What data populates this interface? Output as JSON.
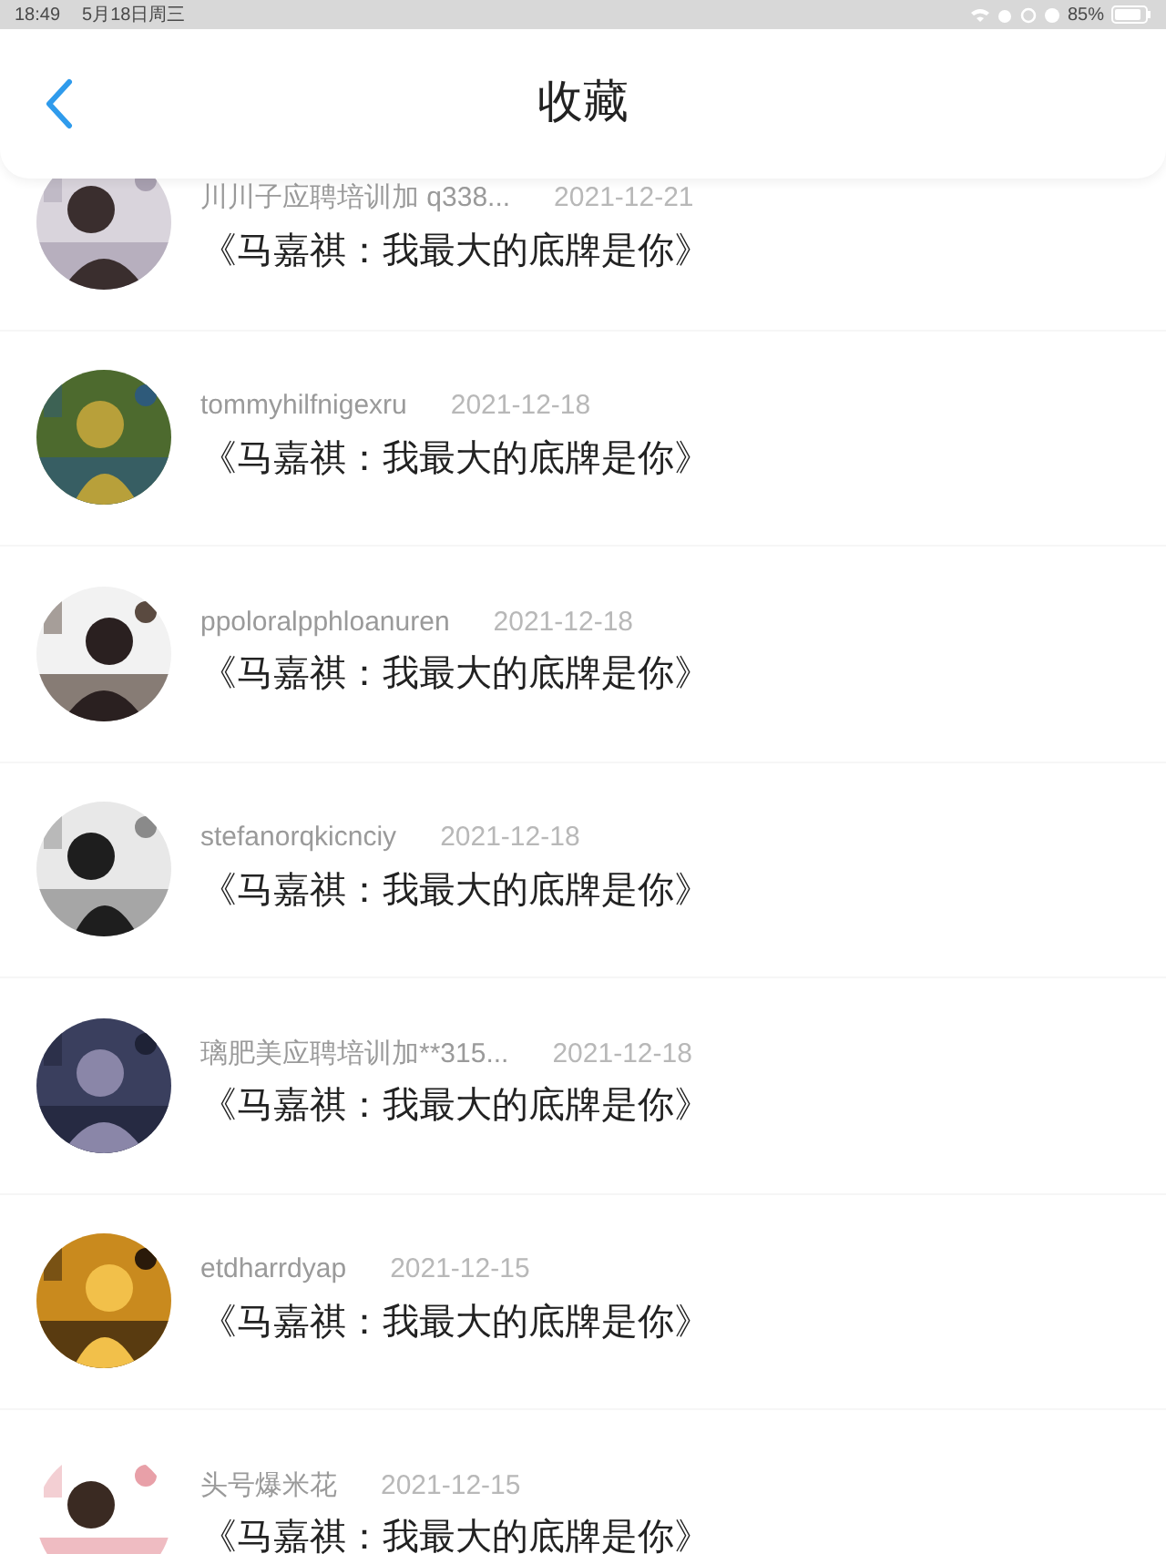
{
  "status_bar": {
    "time": "18:49",
    "date": "5月18日周三",
    "battery": "85%"
  },
  "header": {
    "title": "收藏"
  },
  "items": [
    {
      "author": "川川子应聘培训加 q338...",
      "date": "2021-12-21",
      "title": "《马嘉祺：我最大的底牌是你》"
    },
    {
      "author": "tommyhilfnigexru",
      "date": "2021-12-18",
      "title": "《马嘉祺：我最大的底牌是你》"
    },
    {
      "author": "ppoloralpphloanuren",
      "date": "2021-12-18",
      "title": "《马嘉祺：我最大的底牌是你》"
    },
    {
      "author": "stefanorqkicnciy",
      "date": "2021-12-18",
      "title": "《马嘉祺：我最大的底牌是你》"
    },
    {
      "author": "璃肥美应聘培训加**315...",
      "date": "2021-12-18",
      "title": "《马嘉祺：我最大的底牌是你》"
    },
    {
      "author": "etdharrdyap",
      "date": "2021-12-15",
      "title": "《马嘉祺：我最大的底牌是你》"
    },
    {
      "author": "头号爆米花",
      "date": "2021-12-15",
      "title": "《马嘉祺：我最大的底牌是你》"
    }
  ]
}
